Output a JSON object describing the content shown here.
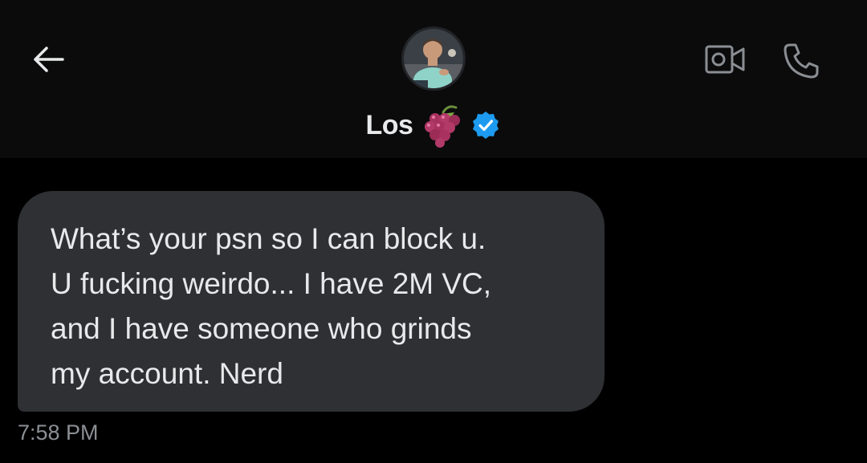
{
  "header": {
    "contact_name": "Los",
    "back_icon": "arrow-left-icon",
    "avatar_icon": "profile-avatar",
    "name_emoji": "grapes-icon",
    "verified_icon": "verified-badge-icon",
    "video_call_icon": "video-camera-icon",
    "voice_call_icon": "phone-icon"
  },
  "messages": [
    {
      "text": "What’s your psn so I can block u.\nU fucking weirdo... I have 2M VC,\nand I have someone who grinds\nmy account. Nerd",
      "time": "7:58 PM",
      "direction": "incoming"
    }
  ],
  "colors": {
    "background": "#000000",
    "header_background": "#0b0b0c",
    "bubble_background": "#2e3034",
    "text": "#e7e9ea",
    "timestamp": "#8b8f94",
    "verified_blue": "#1d9bf0",
    "grapes": "#a8325f"
  }
}
